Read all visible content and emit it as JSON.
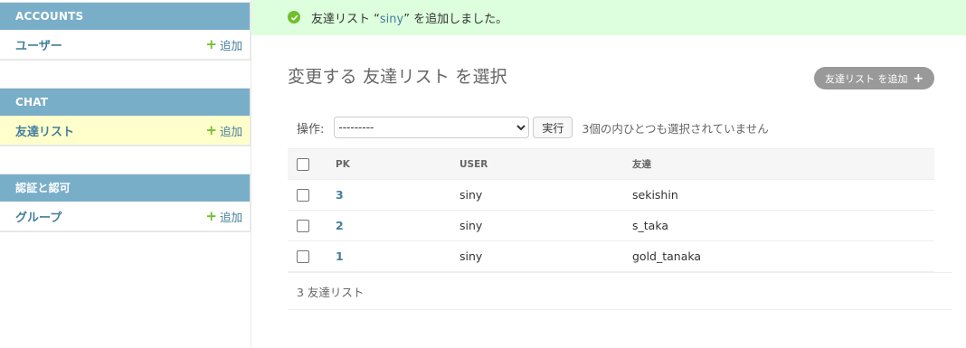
{
  "sidebar": {
    "modules": [
      {
        "caption": "ACCOUNTS",
        "rows": [
          {
            "label": "ユーザー",
            "add_label": "追加"
          }
        ]
      },
      {
        "caption": "CHAT",
        "rows": [
          {
            "label": "友達リスト",
            "add_label": "追加"
          }
        ]
      },
      {
        "caption": "認証と認可",
        "rows": [
          {
            "label": "グループ",
            "add_label": "追加"
          }
        ]
      }
    ]
  },
  "message": {
    "prefix": "友達リスト “",
    "link": "siny",
    "suffix": "” を追加しました。"
  },
  "page": {
    "title": "変更する 友達リスト を選択",
    "add_button": "友達リスト を追加"
  },
  "actions": {
    "label": "操作:",
    "selected": "---------",
    "run_button": "実行",
    "counter": "3個の内ひとつも選択されていません"
  },
  "table": {
    "columns": [
      "PK",
      "USER",
      "友達"
    ],
    "rows": [
      {
        "pk": "3",
        "user": "siny",
        "friend": "sekishin"
      },
      {
        "pk": "2",
        "user": "siny",
        "friend": "s_taka"
      },
      {
        "pk": "1",
        "user": "siny",
        "friend": "gold_tanaka"
      }
    ]
  },
  "paginator": "3 友達リスト",
  "colors": {
    "header": "#79aec8",
    "link": "#447e9b",
    "success_bg": "#ddffdd",
    "add_green": "#70bf2b"
  }
}
